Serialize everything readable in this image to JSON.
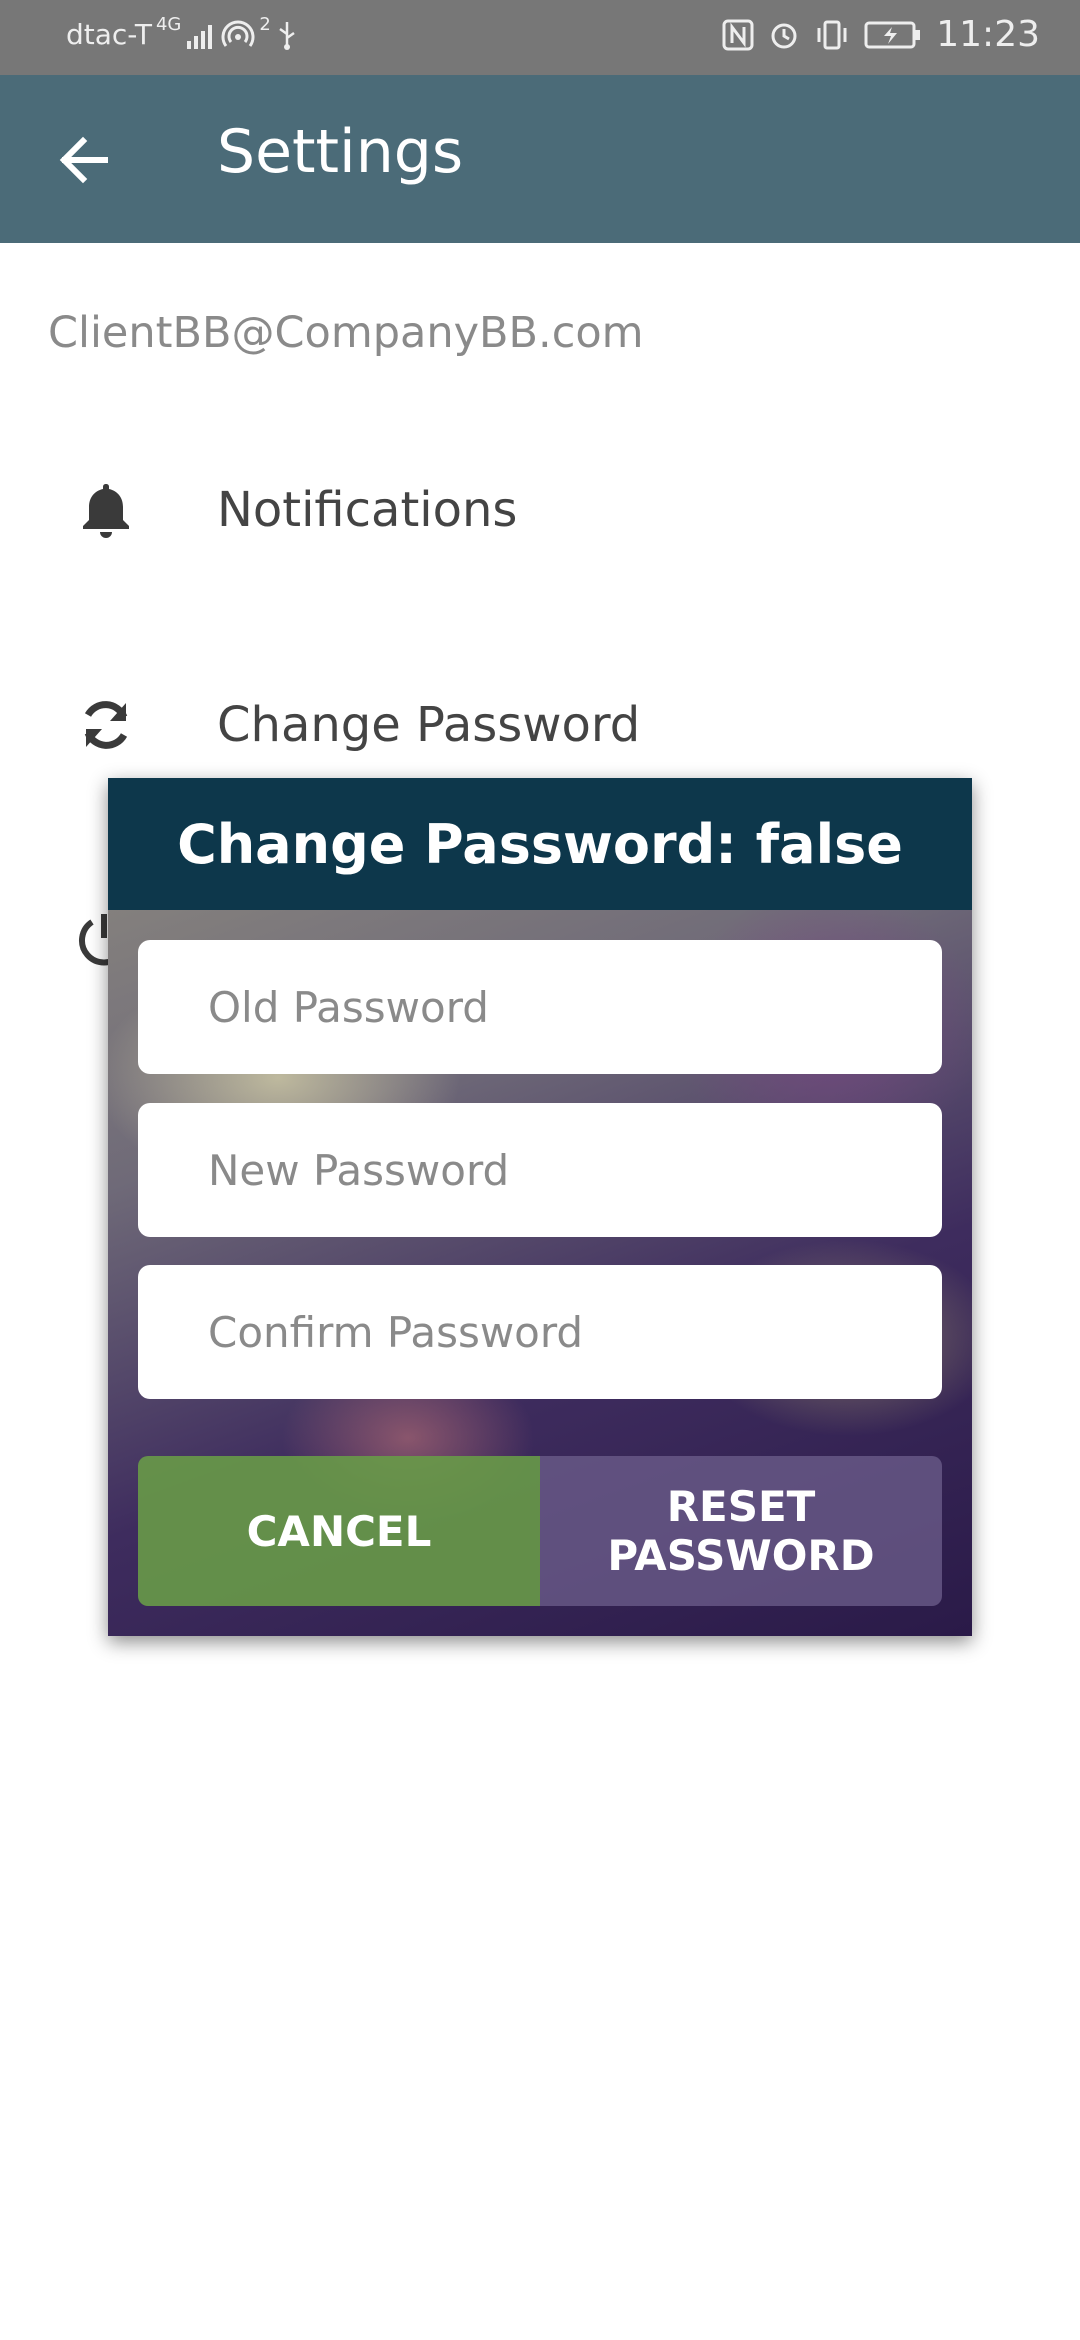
{
  "status_bar": {
    "carrier": "dtac-T",
    "network": "4G",
    "hotspot_count": "2",
    "time": "11:23",
    "icons": [
      "signal-icon",
      "hotspot-icon",
      "usb-icon",
      "nfc-icon",
      "alarm-icon",
      "vibrate-icon",
      "battery-icon"
    ]
  },
  "app_bar": {
    "title": "Settings",
    "back_icon": "arrow-left-icon"
  },
  "account": {
    "email": "ClientBB@CompanyBB.com"
  },
  "settings_items": [
    {
      "label": "Notifications",
      "icon": "bell-icon"
    },
    {
      "label": "Change Password",
      "icon": "refresh-icon"
    }
  ],
  "dialog": {
    "title": "Change Password: false",
    "old_password_placeholder": "Old Password",
    "new_password_placeholder": "New Password",
    "confirm_password_placeholder": "Confirm Password",
    "cancel_label": "CANCEL",
    "reset_label": "RESET PASSWORD"
  },
  "colors": {
    "app_bar": "#4b6b78",
    "dialog_header": "#0d374b",
    "cancel_button": "#689a48",
    "status_bar": "#777777"
  }
}
